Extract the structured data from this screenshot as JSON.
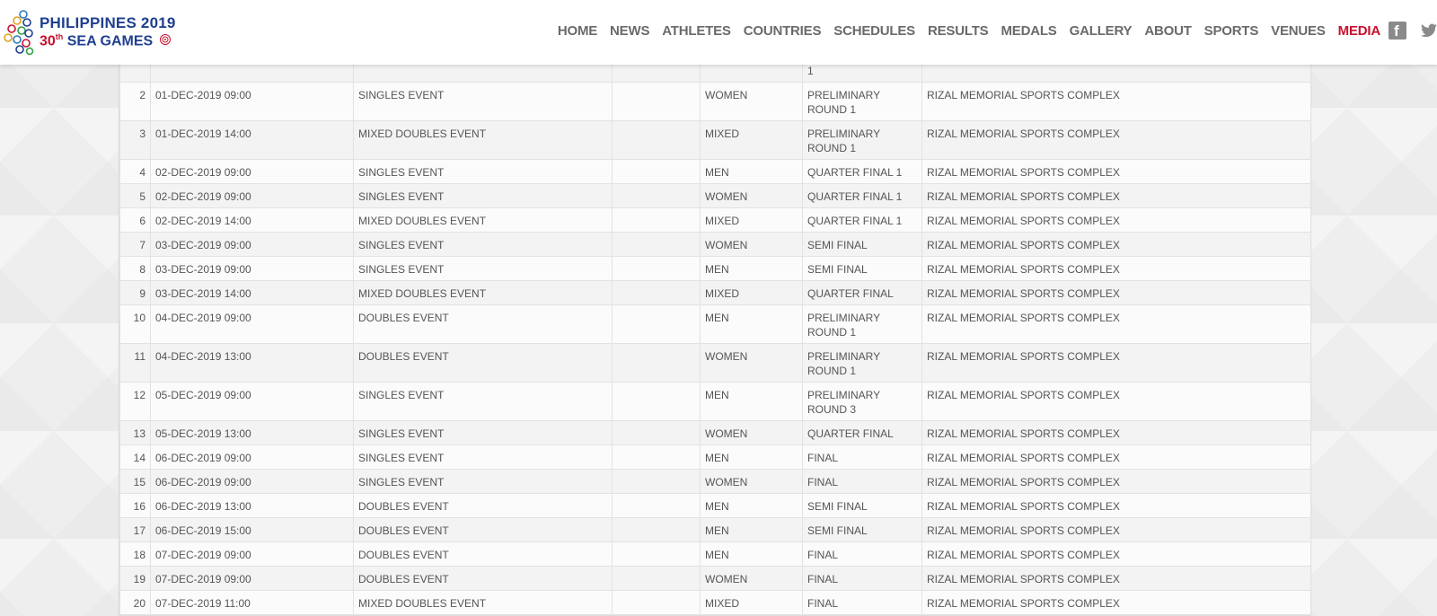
{
  "header": {
    "logo": {
      "line1": "PHILIPPINES 2019",
      "line2_number": "30",
      "line2_suffix": "th",
      "line2_text": " SEA GAMES"
    },
    "nav": [
      "HOME",
      "NEWS",
      "ATHLETES",
      "COUNTRIES",
      "SCHEDULES",
      "RESULTS",
      "MEDALS",
      "GALLERY",
      "ABOUT",
      "SPORTS",
      "VENUES",
      "MEDIA"
    ],
    "active_nav": "MEDIA",
    "social": [
      "facebook-icon",
      "twitter-icon"
    ]
  },
  "colors": {
    "brand_navy": "#1f3f8f",
    "brand_red": "#c8102e"
  },
  "schedule": {
    "partial_top_round_fragment": "1",
    "rows": [
      {
        "no": "2",
        "datetime": "01-DEC-2019 09:00",
        "event": "SINGLES EVENT",
        "extra": "",
        "gender": "WOMEN",
        "round": "PRELIMINARY ROUND 1",
        "venue": "RIZAL MEMORIAL SPORTS COMPLEX"
      },
      {
        "no": "3",
        "datetime": "01-DEC-2019 14:00",
        "event": "MIXED DOUBLES EVENT",
        "extra": "",
        "gender": "MIXED",
        "round": "PRELIMINARY ROUND 1",
        "venue": "RIZAL MEMORIAL SPORTS COMPLEX"
      },
      {
        "no": "4",
        "datetime": "02-DEC-2019 09:00",
        "event": "SINGLES EVENT",
        "extra": "",
        "gender": "MEN",
        "round": "QUARTER FINAL 1",
        "venue": "RIZAL MEMORIAL SPORTS COMPLEX"
      },
      {
        "no": "5",
        "datetime": "02-DEC-2019 09:00",
        "event": "SINGLES EVENT",
        "extra": "",
        "gender": "WOMEN",
        "round": "QUARTER FINAL 1",
        "venue": "RIZAL MEMORIAL SPORTS COMPLEX"
      },
      {
        "no": "6",
        "datetime": "02-DEC-2019 14:00",
        "event": "MIXED DOUBLES EVENT",
        "extra": "",
        "gender": "MIXED",
        "round": "QUARTER FINAL 1",
        "venue": "RIZAL MEMORIAL SPORTS COMPLEX"
      },
      {
        "no": "7",
        "datetime": "03-DEC-2019 09:00",
        "event": "SINGLES EVENT",
        "extra": "",
        "gender": "WOMEN",
        "round": "SEMI FINAL",
        "venue": "RIZAL MEMORIAL SPORTS COMPLEX"
      },
      {
        "no": "8",
        "datetime": "03-DEC-2019 09:00",
        "event": "SINGLES EVENT",
        "extra": "",
        "gender": "MEN",
        "round": "SEMI FINAL",
        "venue": "RIZAL MEMORIAL SPORTS COMPLEX"
      },
      {
        "no": "9",
        "datetime": "03-DEC-2019 14:00",
        "event": "MIXED DOUBLES EVENT",
        "extra": "",
        "gender": "MIXED",
        "round": "QUARTER FINAL",
        "venue": "RIZAL MEMORIAL SPORTS COMPLEX"
      },
      {
        "no": "10",
        "datetime": "04-DEC-2019 09:00",
        "event": "DOUBLES EVENT",
        "extra": "",
        "gender": "MEN",
        "round": "PRELIMINARY ROUND 1",
        "venue": "RIZAL MEMORIAL SPORTS COMPLEX"
      },
      {
        "no": "11",
        "datetime": "04-DEC-2019 13:00",
        "event": "DOUBLES EVENT",
        "extra": "",
        "gender": "WOMEN",
        "round": "PRELIMINARY ROUND 1",
        "venue": "RIZAL MEMORIAL SPORTS COMPLEX"
      },
      {
        "no": "12",
        "datetime": "05-DEC-2019 09:00",
        "event": "SINGLES EVENT",
        "extra": "",
        "gender": "MEN",
        "round": "PRELIMINARY ROUND 3",
        "venue": "RIZAL MEMORIAL SPORTS COMPLEX"
      },
      {
        "no": "13",
        "datetime": "05-DEC-2019 13:00",
        "event": "SINGLES EVENT",
        "extra": "",
        "gender": "WOMEN",
        "round": "QUARTER FINAL",
        "venue": "RIZAL MEMORIAL SPORTS COMPLEX"
      },
      {
        "no": "14",
        "datetime": "06-DEC-2019 09:00",
        "event": "SINGLES EVENT",
        "extra": "",
        "gender": "MEN",
        "round": "FINAL",
        "venue": "RIZAL MEMORIAL SPORTS COMPLEX"
      },
      {
        "no": "15",
        "datetime": "06-DEC-2019 09:00",
        "event": "SINGLES EVENT",
        "extra": "",
        "gender": "WOMEN",
        "round": "FINAL",
        "venue": "RIZAL MEMORIAL SPORTS COMPLEX"
      },
      {
        "no": "16",
        "datetime": "06-DEC-2019 13:00",
        "event": "DOUBLES EVENT",
        "extra": "",
        "gender": "MEN",
        "round": "SEMI FINAL",
        "venue": "RIZAL MEMORIAL SPORTS COMPLEX"
      },
      {
        "no": "17",
        "datetime": "06-DEC-2019 15:00",
        "event": "DOUBLES EVENT",
        "extra": "",
        "gender": "MEN",
        "round": "SEMI FINAL",
        "venue": "RIZAL MEMORIAL SPORTS COMPLEX"
      },
      {
        "no": "18",
        "datetime": "07-DEC-2019 09:00",
        "event": "DOUBLES EVENT",
        "extra": "",
        "gender": "MEN",
        "round": "FINAL",
        "venue": "RIZAL MEMORIAL SPORTS COMPLEX"
      },
      {
        "no": "19",
        "datetime": "07-DEC-2019 09:00",
        "event": "DOUBLES EVENT",
        "extra": "",
        "gender": "WOMEN",
        "round": "FINAL",
        "venue": "RIZAL MEMORIAL SPORTS COMPLEX"
      },
      {
        "no": "20",
        "datetime": "07-DEC-2019 11:00",
        "event": "MIXED DOUBLES EVENT",
        "extra": "",
        "gender": "MIXED",
        "round": "FINAL",
        "venue": "RIZAL MEMORIAL SPORTS COMPLEX"
      }
    ]
  }
}
